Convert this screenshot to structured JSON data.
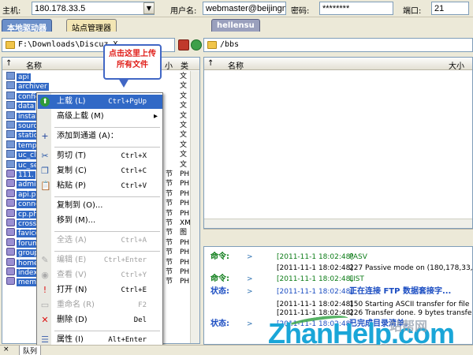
{
  "connection": {
    "host_label": "主机:",
    "host_value": "180.178.33.5",
    "user_label": "用户名:",
    "user_value": "webmaster@beijingn",
    "pass_label": "密码:",
    "pass_value": "********",
    "port_label": "端口:",
    "port_value": "21"
  },
  "local": {
    "tab_active": "本地驱动器",
    "tab_inactive": "站点管理器",
    "path": "F:\\Downloads\\Discuz_X",
    "col_name": "名称",
    "col_size": "小",
    "col_type": "类",
    "files": [
      {
        "name": "api",
        "type": "文",
        "kind": "dir"
      },
      {
        "name": "archiver",
        "type": "文",
        "kind": "dir"
      },
      {
        "name": "config",
        "type": "文",
        "kind": "dir"
      },
      {
        "name": "data",
        "type": "文",
        "kind": "dir"
      },
      {
        "name": "install",
        "type": "文",
        "kind": "dir"
      },
      {
        "name": "source",
        "type": "文",
        "kind": "dir"
      },
      {
        "name": "static",
        "type": "文",
        "kind": "dir"
      },
      {
        "name": "template",
        "type": "文",
        "kind": "dir"
      },
      {
        "name": "uc_client",
        "type": "文",
        "kind": "dir"
      },
      {
        "name": "uc_server",
        "type": "文",
        "kind": "dir"
      },
      {
        "name": "111.",
        "size": "节",
        "type": "PH",
        "kind": "file"
      },
      {
        "name": "admin",
        "size": "节",
        "type": "PH",
        "kind": "file"
      },
      {
        "name": "api.p",
        "size": "节",
        "type": "PH",
        "kind": "file"
      },
      {
        "name": "connect",
        "size": "节",
        "type": "PH",
        "kind": "file"
      },
      {
        "name": "cp.ph",
        "size": "节",
        "type": "PH",
        "kind": "file"
      },
      {
        "name": "cross",
        "size": "节",
        "type": "XM",
        "kind": "file"
      },
      {
        "name": "favicon",
        "size": "节",
        "type": "图",
        "kind": "file"
      },
      {
        "name": "forum",
        "size": "节",
        "type": "PH",
        "kind": "file"
      },
      {
        "name": "group",
        "size": "节",
        "type": "PH",
        "kind": "file"
      },
      {
        "name": "home.",
        "size": "节",
        "type": "PH",
        "kind": "file"
      },
      {
        "name": "index",
        "size": "节",
        "type": "PH",
        "kind": "file"
      },
      {
        "name": "member",
        "size": "节",
        "type": "PH",
        "kind": "file"
      }
    ]
  },
  "remote": {
    "tab": "hellensu",
    "path": "/bbs",
    "col_name": "名称",
    "col_size": "大小"
  },
  "callout": {
    "text": "点击这里上传所有文件"
  },
  "context_menu": {
    "items": [
      {
        "icon": "upload-icon",
        "label": "上载 (L)",
        "shortcut": "Ctrl+PgUp",
        "state": "highlight"
      },
      {
        "label": "高级上载 (M)",
        "submenu": true,
        "state": "normal"
      },
      {
        "sep": true
      },
      {
        "icon": "plus-icon",
        "label": "添加到通道 (A)：",
        "state": "normal"
      },
      {
        "sep": true
      },
      {
        "icon": "cut-icon",
        "label": "剪切 (T)",
        "shortcut": "Ctrl+X",
        "state": "normal"
      },
      {
        "icon": "copy-icon",
        "label": "复制 (C)",
        "shortcut": "Ctrl+C",
        "state": "normal"
      },
      {
        "icon": "paste-icon",
        "label": "粘贴 (P)",
        "shortcut": "Ctrl+V",
        "state": "normal"
      },
      {
        "sep": true
      },
      {
        "label": "复制到 (O)...",
        "state": "normal"
      },
      {
        "label": "移到 (M)...",
        "state": "normal"
      },
      {
        "sep": true
      },
      {
        "label": "全选 (A)",
        "shortcut": "Ctrl+A",
        "state": "disabled"
      },
      {
        "sep": true
      },
      {
        "icon": "edit-icon",
        "label": "编辑 (E)",
        "shortcut": "Ctrl+Enter",
        "state": "disabled"
      },
      {
        "icon": "view-icon",
        "label": "查看 (V)",
        "shortcut": "Ctrl+Y",
        "state": "disabled"
      },
      {
        "icon": "exclaim-icon",
        "label": "打开 (N)",
        "shortcut": "Ctrl+E",
        "state": "normal"
      },
      {
        "icon": "rename-icon",
        "label": "重命名 (R)",
        "shortcut": "F2",
        "state": "disabled"
      },
      {
        "icon": "delete-icon",
        "label": "删除 (D)",
        "shortcut": "Del",
        "state": "normal"
      },
      {
        "sep": true
      },
      {
        "icon": "properties-icon",
        "label": "属性 (I)",
        "shortcut": "Alt+Enter",
        "state": "normal"
      }
    ]
  },
  "log": [
    {
      "kind": "命令:",
      "kclass": "cmd",
      "arrow": ">",
      "ts": "[2011-11-1 18:02:48]",
      "tsc": "green",
      "msg": "PASV",
      "mc": "green"
    },
    {
      "kind": "",
      "arrow": "",
      "ts": "[2011-11-1 18:02:48]",
      "tsc": "black",
      "msg": "227 Passive mode on (180,178,33,5,",
      "mc": "black"
    },
    {
      "kind": "命令:",
      "kclass": "cmd",
      "arrow": ">",
      "ts": "[2011-11-1 18:02:48]",
      "tsc": "green",
      "msg": "LIST",
      "mc": "green"
    },
    {
      "kind": "状态:",
      "kclass": "st",
      "arrow": ">",
      "ts": "[2011-11-1 18:02:48]",
      "tsc": "blue",
      "msg": "正在连接 FTP 数据套接字...",
      "mc": "blue"
    },
    {
      "kind": "",
      "arrow": "",
      "ts": "[2011-11-1 18:02:48]",
      "tsc": "black",
      "msg": "150 Starting ASCII transfer for file lis",
      "mc": "black"
    },
    {
      "kind": "",
      "arrow": "",
      "ts": "[2011-11-1 18:02:48]",
      "tsc": "black",
      "msg": "226 Transfer done. 9 bytes transferr",
      "mc": "black"
    },
    {
      "kind": "状态:",
      "kclass": "st",
      "arrow": ">",
      "ts": "[2011-11-1 18:02:48]",
      "tsc": "blue",
      "msg": "已完成目录清单。",
      "mc": "blue"
    }
  ],
  "bottom_tab": "队列",
  "watermark": {
    "text": "ZhanHelp.com",
    "sub": "站帮网"
  }
}
